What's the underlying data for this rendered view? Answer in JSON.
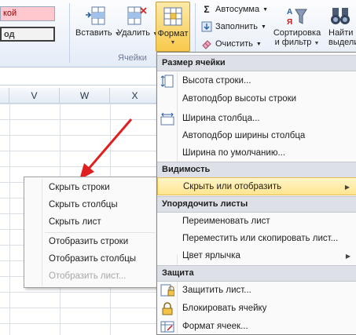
{
  "ribbon": {
    "style_cells": [
      "кой",
      "од"
    ],
    "insert_label": "Вставить",
    "delete_label": "Удалить",
    "format_label": "Формат",
    "cells_group_label": "Ячейки",
    "autosum_label": "Автосумма",
    "fill_label": "Заполнить",
    "clear_label": "Очистить",
    "sort_label_1": "Сортировка",
    "sort_label_2": "и фильтр",
    "find_label_1": "Найти",
    "find_label_2": "выдели"
  },
  "sheet": {
    "columns": [
      "V",
      "W",
      "X"
    ]
  },
  "context_submenu": {
    "items": [
      "Скрыть строки",
      "Скрыть столбцы",
      "Скрыть лист",
      "Отобразить строки",
      "Отобразить столбцы",
      "Отобразить лист..."
    ]
  },
  "format_menu": {
    "section_cell_size": "Размер ячейки",
    "row_height": "Высота строки...",
    "autofit_row": "Автоподбор высоты строки",
    "col_width": "Ширина столбца...",
    "autofit_col": "Автоподбор ширины столбца",
    "default_width": "Ширина по умолчанию...",
    "section_visibility": "Видимость",
    "hide_unhide": "Скрыть или отобразить",
    "section_organize": "Упорядочить листы",
    "rename_sheet": "Переименовать лист",
    "move_copy_sheet": "Переместить или скопировать лист...",
    "tab_color": "Цвет ярлычка",
    "section_protection": "Защита",
    "protect_sheet": "Защитить лист...",
    "lock_cell": "Блокировать ячейку",
    "format_cells": "Формат ячеек..."
  },
  "colors": {
    "accent_highlight": "#ffe58f",
    "arrow": "#e02020"
  }
}
